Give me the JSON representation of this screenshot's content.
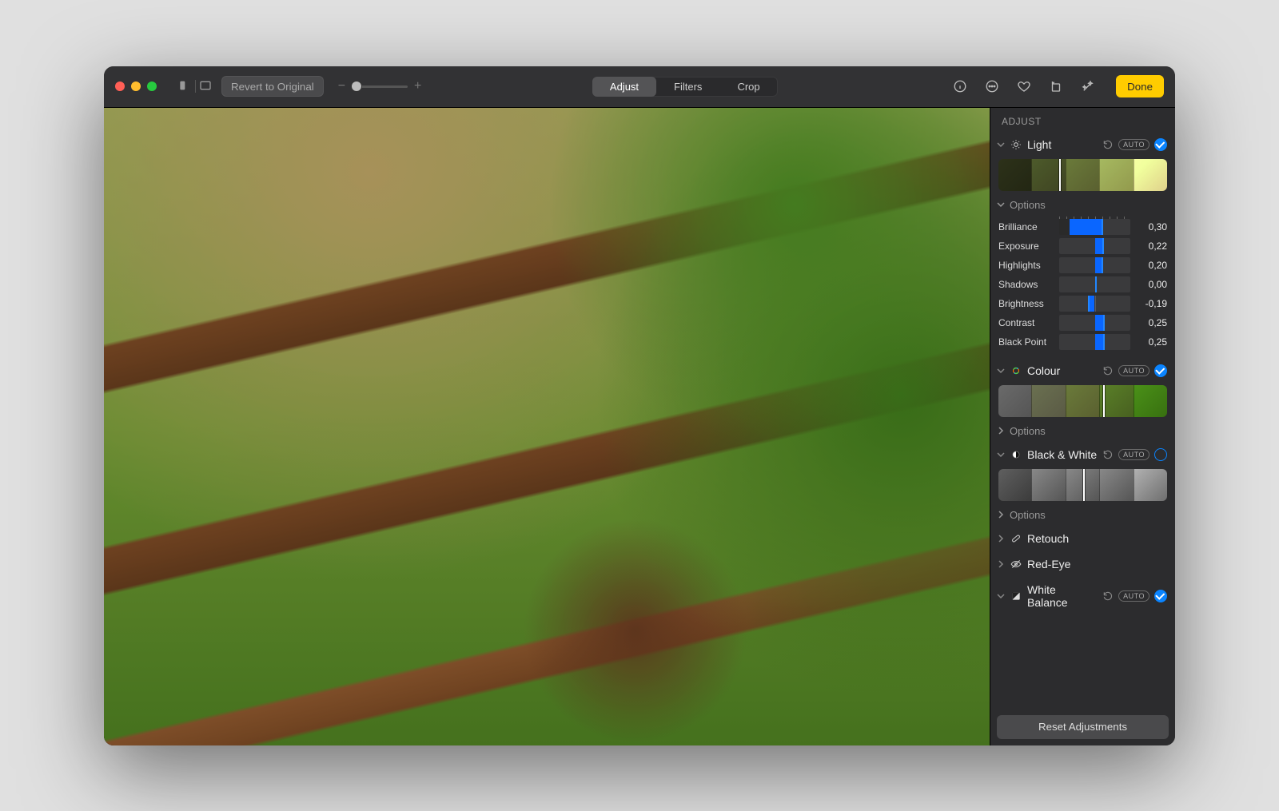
{
  "toolbar": {
    "revert_label": "Revert to Original",
    "modes": {
      "adjust": "Adjust",
      "filters": "Filters",
      "crop": "Crop"
    },
    "done_label": "Done"
  },
  "sidebar": {
    "header": "ADJUST",
    "auto_label": "AUTO",
    "options_label": "Options",
    "light": {
      "title": "Light",
      "strip_marker_pct": 36,
      "sliders": [
        {
          "key": "brilliance",
          "label": "Brilliance",
          "value": 0.3,
          "display": "0,30",
          "origin_pct": 15,
          "handle_pct": 60
        },
        {
          "key": "exposure",
          "label": "Exposure",
          "value": 0.22,
          "display": "0,22",
          "origin_pct": 50,
          "handle_pct": 61
        },
        {
          "key": "highlights",
          "label": "Highlights",
          "value": 0.2,
          "display": "0,20",
          "origin_pct": 50,
          "handle_pct": 60
        },
        {
          "key": "shadows",
          "label": "Shadows",
          "value": 0.0,
          "display": "0,00",
          "origin_pct": 50,
          "handle_pct": 50
        },
        {
          "key": "brightness",
          "label": "Brightness",
          "value": -0.19,
          "display": "-0,19",
          "origin_pct": 50,
          "handle_pct": 40
        },
        {
          "key": "contrast",
          "label": "Contrast",
          "value": 0.25,
          "display": "0,25",
          "origin_pct": 50,
          "handle_pct": 62
        },
        {
          "key": "black_point",
          "label": "Black Point",
          "value": 0.25,
          "display": "0,25",
          "origin_pct": 50,
          "handle_pct": 62
        }
      ]
    },
    "colour": {
      "title": "Colour",
      "strip_marker_pct": 62
    },
    "bw": {
      "title": "Black & White",
      "strip_marker_pct": 50
    },
    "retouch": {
      "title": "Retouch"
    },
    "redeye": {
      "title": "Red-Eye"
    },
    "white_balance": {
      "title": "White Balance"
    },
    "reset_label": "Reset Adjustments"
  }
}
